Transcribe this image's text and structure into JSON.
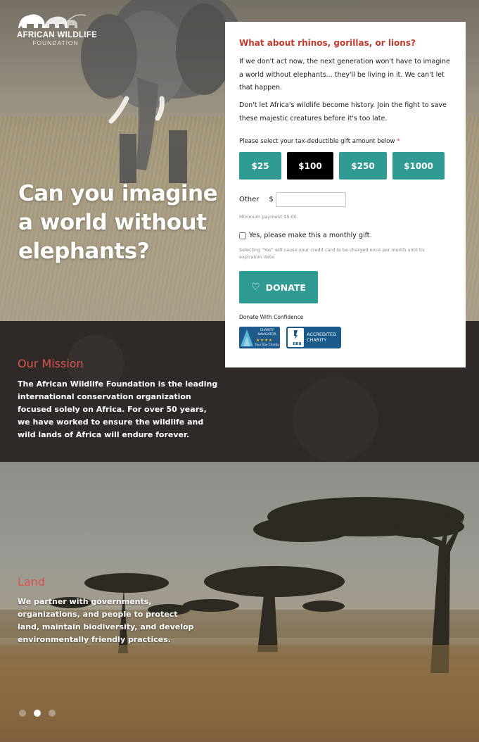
{
  "brand": {
    "name": "AFRICAN WILDLIFE",
    "sub": "FOUNDATION"
  },
  "hero": {
    "headline": "Can you imagine a world without elephants?"
  },
  "donation": {
    "heading": "What about rhinos, gorillas, or lions?",
    "para1": "If we don't act now, the next generation won't have to imagine a world without elephants... they'll be living in it. We can't let that happen.",
    "para2": "Don't let Africa's wildlife become history. Join the fight to save these majestic creatures before it's too late.",
    "gift_label": "Please select your tax-deductible gift amount below",
    "required_mark": "*",
    "amounts": [
      "$25",
      "$100",
      "$250",
      "$1000"
    ],
    "selected_amount": "$100",
    "other_label": "Other",
    "currency_symbol": "$",
    "other_value": "",
    "min_payment": "Minimum payment $5.00.",
    "monthly_label": "Yes, please make this a monthly gift.",
    "monthly_checked": false,
    "monthly_note": "Selecting \"Yes\" will cause your credit card to be charged once per month until its expiration date.",
    "donate_label": "DONATE",
    "confidence_label": "Donate With Confidence",
    "charity_navigator": {
      "line1": "CHARITY",
      "line2": "NAVIGATOR",
      "stars": "★★★★",
      "tag": "Four Star Charity"
    },
    "bbb": {
      "logo": "BBB",
      "line1": "ACCREDITED",
      "line2": "CHARITY"
    }
  },
  "mission": {
    "title": "Our Mission",
    "body": "The African Wildlife Foundation is the leading international conservation organization focused solely on Africa. For over 50 years, we have worked to ensure the wildlife and wild lands of Africa will endure forever."
  },
  "slider": {
    "title": "Land",
    "body": "We partner with governments, organizations, and people to protect land, maintain biodiversity, and develop environmentally friendly practices.",
    "total_slides": 3,
    "active_slide": 2
  },
  "colors": {
    "accent_teal": "#2f9b93",
    "heading_red": "#c0392b",
    "dark_band": "#2f2a28"
  }
}
